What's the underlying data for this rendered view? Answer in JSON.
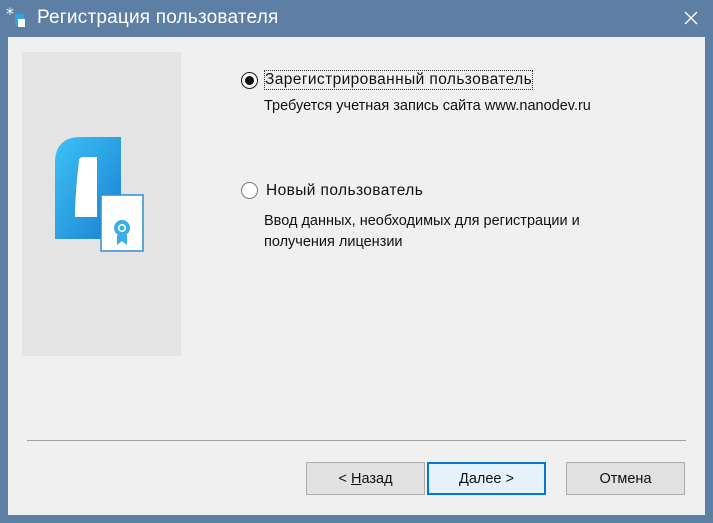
{
  "window": {
    "title": "Регистрация пользователя",
    "title_icon": "app-icon",
    "close_icon": "close-icon"
  },
  "options": [
    {
      "label": "Зарегистрированный пользователь",
      "description": "Требуется учетная запись сайта www.nanodev.ru",
      "selected": true
    },
    {
      "label": "Новый пользователь",
      "description": "Ввод данных, необходимых для регистрации и получения лицензии",
      "selected": false
    }
  ],
  "buttons": {
    "back": {
      "prefix": "< ",
      "hotkey": "Н",
      "rest": "азад"
    },
    "next": {
      "hotkey": "Д",
      "rest": "алее >"
    },
    "cancel": "Отмена"
  },
  "colors": {
    "titlebar": "#5d7fa3",
    "client_bg": "#f0f0f0",
    "logo_blue": "#2aa7e6",
    "default_button_border": "#0078d7"
  }
}
